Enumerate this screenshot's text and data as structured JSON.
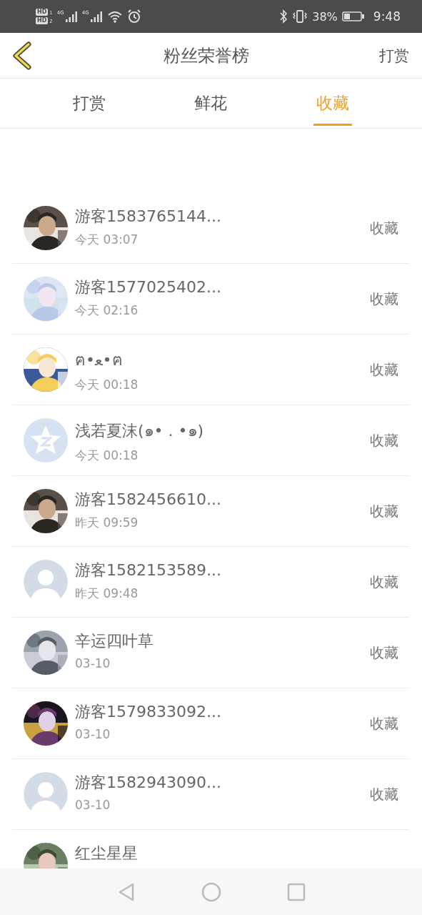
{
  "status_bar": {
    "hd_badges": [
      {
        "label": "HD",
        "slot": "1"
      },
      {
        "label": "HD",
        "slot": "2"
      }
    ],
    "signals": [
      {
        "network": "4G"
      },
      {
        "network": "4G"
      }
    ],
    "battery_percent": "38%",
    "time": "9:48"
  },
  "header": {
    "title": "粉丝荣誉榜",
    "action": "打赏"
  },
  "tabs": [
    {
      "label": "打赏",
      "selected": false
    },
    {
      "label": "鲜花",
      "selected": false
    },
    {
      "label": "收藏",
      "selected": true
    }
  ],
  "rows": [
    {
      "name": "游客1583765144...",
      "time": "今天 03:07",
      "action": "收藏"
    },
    {
      "name": "游客1577025402...",
      "time": "今天 02:16",
      "action": "收藏"
    },
    {
      "name": "ฅ•ﻌ•ฅ",
      "time": "今天 00:18",
      "action": "收藏"
    },
    {
      "avatar": {
        "kind": "star"
      },
      "name": "浅若夏沫(๑• . •๑)",
      "time": "今天 00:18",
      "action": "收藏"
    },
    {
      "name": "游客1582456610...",
      "time": "昨天 09:59",
      "action": "收藏"
    },
    {
      "avatar": {
        "kind": "default"
      },
      "name": "游客1582153589...",
      "time": "昨天 09:48",
      "action": "收藏"
    },
    {
      "name": "辛运四叶草",
      "time": "03-10",
      "action": "收藏"
    },
    {
      "name": "游客1579833092...",
      "time": "03-10",
      "action": "收藏"
    },
    {
      "avatar": {
        "kind": "default"
      },
      "name": "游客1582943090...",
      "time": "03-10",
      "action": "收藏"
    },
    {
      "name": "红尘星星"
    }
  ]
}
